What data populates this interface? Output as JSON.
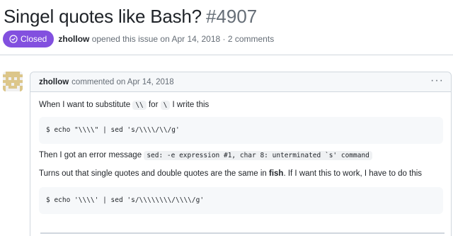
{
  "issue": {
    "title": "Singel quotes like Bash?",
    "number": "#4907",
    "state": "Closed",
    "author": "zhollow",
    "opened_text": "opened this issue on Apr 14, 2018 · 2 comments"
  },
  "comment": {
    "author": "zhollow",
    "action": "commented on Apr 14, 2018",
    "menu_icon": "kebab-horizontal-icon",
    "line1": {
      "pre": "When I want to substitute",
      "code1": "\\\\",
      "mid": "for",
      "code2": "\\",
      "post": "I write this"
    },
    "code_block_1": "$ echo \"\\\\\\\\\" | sed 's/\\\\\\\\/\\\\/g'",
    "line2": {
      "pre": "Then I got an error message",
      "code": "sed: -e expression #1, char 8: unterminated `s' command"
    },
    "line3": {
      "pre": "Turns out that single quotes and double quotes are the same in",
      "bold": "fish",
      "post": ". If I want this to work, I have to do this"
    },
    "code_block_2": "$ echo '\\\\\\\\' | sed 's/\\\\\\\\\\\\\\\\/\\\\\\\\/g'"
  },
  "colors": {
    "closed_badge": "#8250df",
    "muted_text": "#656d76",
    "border": "#d0d7de",
    "code_bg": "#f6f8fa"
  }
}
